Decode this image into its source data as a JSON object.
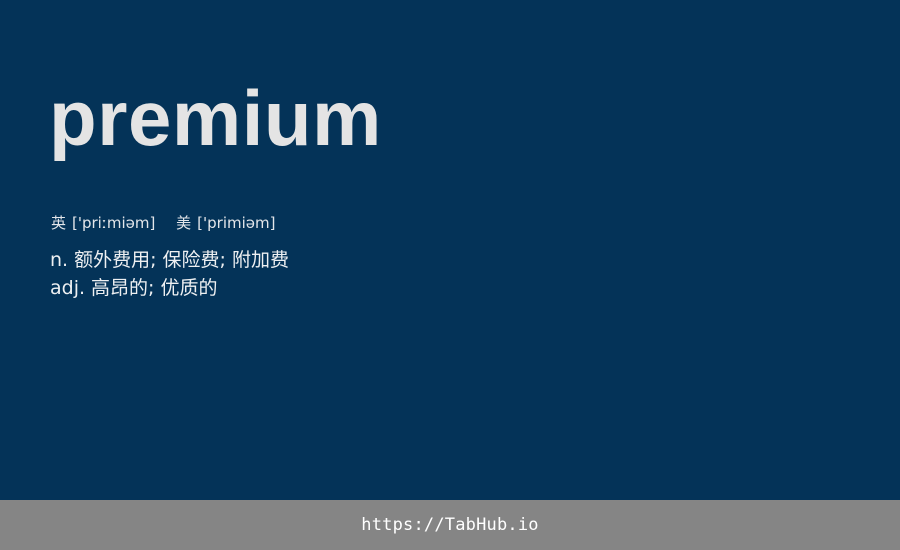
{
  "word": "premium",
  "phonetics": [
    {
      "region": "英",
      "ipa": "['priːmiəm]"
    },
    {
      "region": "美",
      "ipa": "['primiəm]"
    }
  ],
  "definitions": [
    {
      "pos": "n.",
      "meaning": "额外费用; 保险费; 附加费"
    },
    {
      "pos": "adj.",
      "meaning": "高昂的; 优质的"
    }
  ],
  "footer": {
    "url": "https://TabHub.io"
  },
  "colors": {
    "background": "#043358",
    "word": "#e4e4e4",
    "footer_background": "#858585",
    "footer_text": "#ffffff"
  }
}
